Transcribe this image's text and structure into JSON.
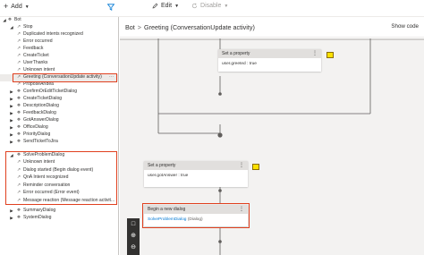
{
  "toolbar": {
    "add_label": "Add",
    "edit_label": "Edit",
    "disable_label": "Disable"
  },
  "tree": {
    "root_label": "Bot",
    "bot_children": [
      "Stop",
      "Duplicated intents recognized",
      "Error occurred",
      "Feedback",
      "CreateTicket",
      "UserThanks",
      "Unknown intent",
      "Greeting (ConversationUpdate activity)",
      "ProposeArIdea"
    ],
    "dialogs": [
      "ConfirmOrEditTicketDialog",
      "CreateTicketDialog",
      "DescriptionDialog",
      "FeedbackDialog",
      "GotAnswerDialog",
      "OfficeDialog",
      "PriorityDialog",
      "SendTicketToJira"
    ],
    "solve_dialog": "SolveProblemDialog",
    "solve_children": [
      "Unknown intent",
      "Dialog started (Begin dialog event)",
      "QnA Intent recognized",
      "Reminder conversation",
      "Error occurred (Error event)",
      "Message reaction (Message reaction activit..."
    ],
    "after_dialogs": [
      "SummaryDialog",
      "SystemDialog"
    ]
  },
  "canvas": {
    "breadcrumb_root": "Bot",
    "breadcrumb_separator": ">",
    "breadcrumb_current": "Greeting (ConversationUpdate activity)",
    "show_code_label": "Show code",
    "node1": {
      "title": "Set a property",
      "body": "user.greeted : true"
    },
    "node2": {
      "title": "Set a property",
      "body": "user.gotAnswer : true"
    },
    "node3": {
      "title": "Begin a new dialog",
      "link": "SolveProblemDialog",
      "suffix": "(Dialog)"
    }
  },
  "colors": {
    "highlight_border": "#e0401f",
    "link": "#0078d4",
    "canvas_bg": "#f3f2f1",
    "node_header": "#e1dfdd"
  }
}
